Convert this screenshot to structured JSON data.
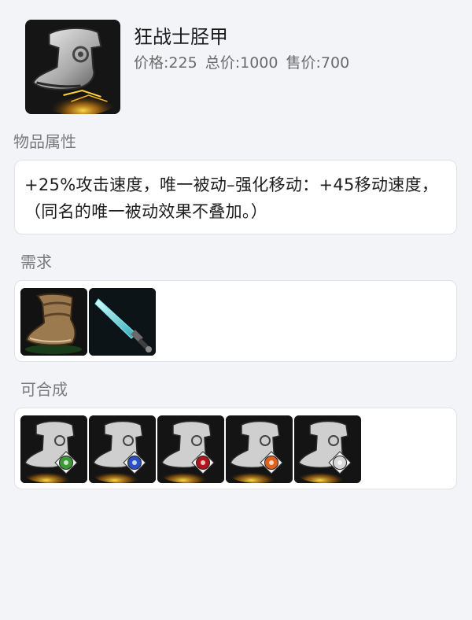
{
  "item": {
    "name": "狂战士胫甲",
    "price_label": "价格:225",
    "total_label": "总价:1000",
    "sell_label": "售价:700"
  },
  "sections": {
    "attributes_title": "物品属性",
    "attributes_text": "+25%攻击速度，唯一被动–强化移动：+45移动速度，（同名的唯一被动效果不叠加。）",
    "requires_title": "需求",
    "builds_into_title": "可合成"
  },
  "requires": [
    {
      "icon": "boots-icon"
    },
    {
      "icon": "dagger-icon"
    }
  ],
  "builds_into": [
    {
      "icon": "greaves-green-enchant-icon",
      "badge_color": "#3c9a35"
    },
    {
      "icon": "greaves-blue-enchant-icon",
      "badge_color": "#2b4fc4"
    },
    {
      "icon": "greaves-red-enchant-icon",
      "badge_color": "#b3141a"
    },
    {
      "icon": "greaves-orange-enchant-icon",
      "badge_color": "#e0611c"
    },
    {
      "icon": "greaves-silver-enchant-icon",
      "badge_color": "#d7d7d7"
    }
  ]
}
